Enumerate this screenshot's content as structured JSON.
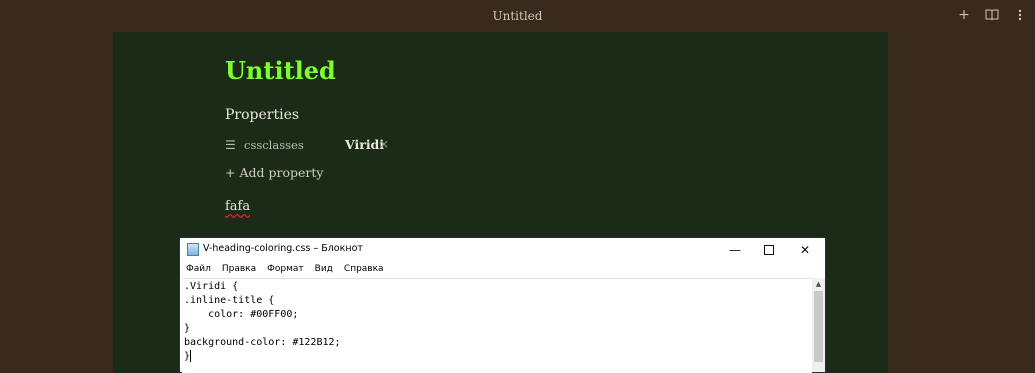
{
  "window": {
    "title": "Untitled"
  },
  "toolbar": {
    "new_tab_glyph": "+",
    "reading_view_icon": "book-open-icon",
    "more_options_icon": "more-vertical-icon"
  },
  "note": {
    "inline_title": "Untitled",
    "inline_title_color": "#00FF00",
    "background_color": "#122B12",
    "properties_heading": "Properties",
    "property": {
      "key": "cssclasses",
      "value": "Viridi",
      "remove_glyph": "×"
    },
    "add_property_label": "Add property",
    "body_text": "fafa"
  },
  "notepad": {
    "title": "V-heading-coloring.css – Блокнот",
    "menu": [
      "Файл",
      "Правка",
      "Формат",
      "Вид",
      "Справка"
    ],
    "lines": [
      ".Viridi {",
      ".inline-title {",
      "    color: #00FF00;",
      "}",
      "background-color: #122B12;",
      "}"
    ]
  }
}
